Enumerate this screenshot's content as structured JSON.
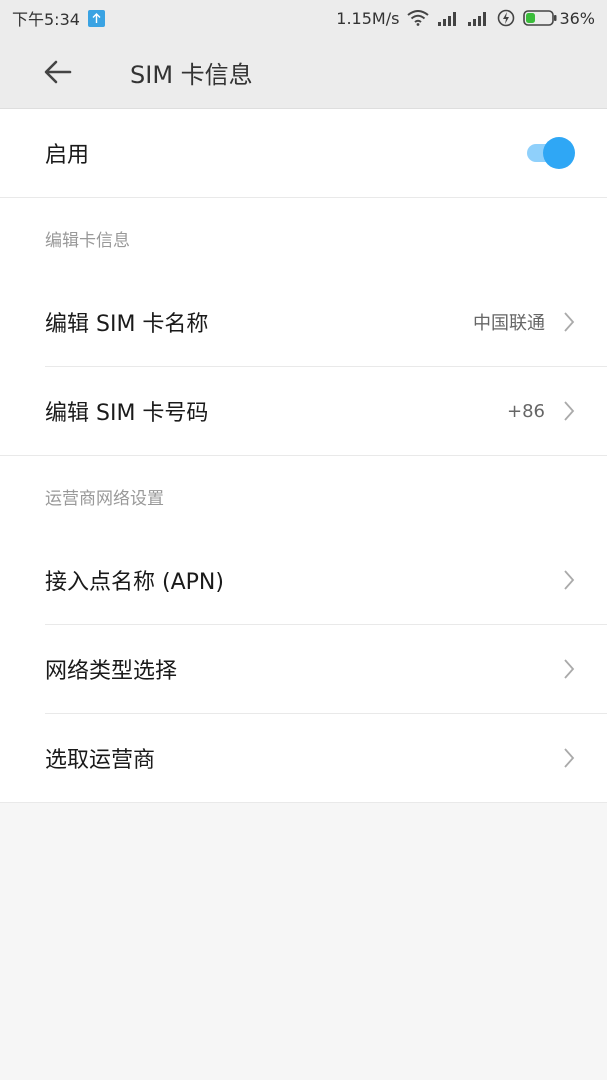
{
  "status_bar": {
    "time": "下午5:34",
    "network_speed": "1.15M/s",
    "battery_percent": "36%",
    "battery_level": 0.36,
    "icons": [
      "upload-icon",
      "wifi-icon",
      "signal-icon",
      "signal-icon",
      "charging-icon",
      "battery-icon"
    ]
  },
  "header": {
    "title": "SIM  卡信息",
    "back_icon": "back-arrow-icon"
  },
  "enable_row": {
    "label": "启用",
    "toggle_on": true
  },
  "sections": {
    "edit_card": {
      "header": "编辑卡信息",
      "items": [
        {
          "label": "编辑 SIM 卡名称",
          "value": "中国联通"
        },
        {
          "label": "编辑 SIM 卡号码",
          "value": "+86"
        }
      ]
    },
    "carrier": {
      "header": "运营商网络设置",
      "items": [
        {
          "label": "接入点名称 (APN)"
        },
        {
          "label": "网络类型选择"
        },
        {
          "label": "选取运营商"
        }
      ]
    }
  },
  "colors": {
    "accent": "#2fa7f5",
    "toggle_track": "#8fd0fb",
    "battery_fill": "#3bbd3b",
    "upload_badge": "#3aa3e3"
  }
}
